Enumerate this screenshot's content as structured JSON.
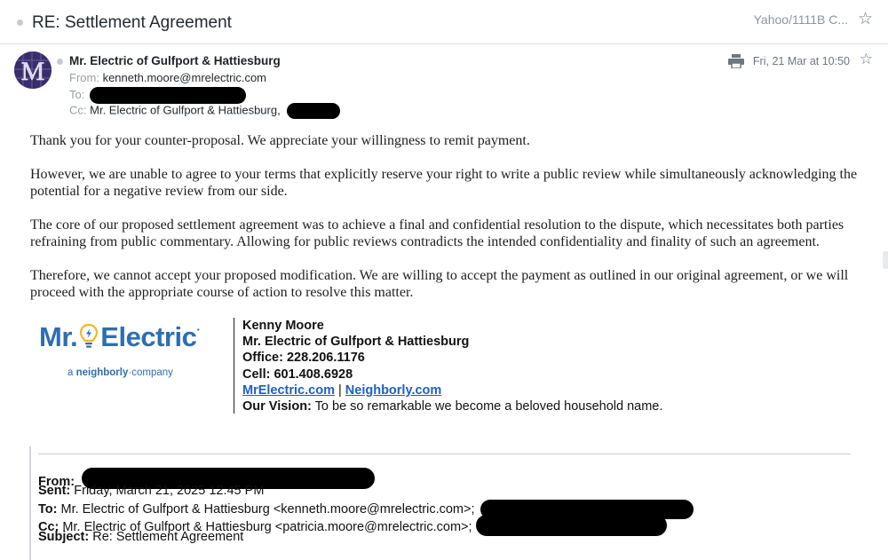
{
  "header": {
    "subject": "RE: Settlement Agreement",
    "folder": "Yahoo/1111B C...",
    "star_icon": "star-outline-icon"
  },
  "message": {
    "sender_name": "Mr. Electric of Gulfport & Hattiesburg",
    "from_label": "From:",
    "from_email": "kenneth.moore@mrelectric.com",
    "to_label": "To:",
    "cc_label": "Cc:",
    "cc_value": "Mr. Electric of Gulfport & Hattiesburg,",
    "date": "Fri, 21 Mar at 10:50",
    "avatar_icon": "avatar-logo-icon",
    "print_icon": "print-icon"
  },
  "body": {
    "p1": "Thank you for your counter-proposal. We appreciate your willingness to remit payment.",
    "p2": "However, we are unable to agree to your terms that explicitly reserve your right to write a public review while simultaneously acknowledging the potential for a negative review from our side.",
    "p3": "The core of our proposed settlement agreement was to achieve a final and confidential resolution to the dispute, which necessitates both parties refraining from public commentary. Allowing for public reviews contradicts the intended confidentiality and finality of such an agreement.",
    "p4": "Therefore, we cannot accept your proposed modification. We are willing to accept the payment as outlined in our original agreement, or we will proceed with the appropriate course of action to resolve this matter."
  },
  "logo": {
    "word_left": "Mr.",
    "word_right": "Electric",
    "reg": "·",
    "tag_a": "a ",
    "tag_brand": "neighborly",
    "tag_rest": "company",
    "brand_color": "#2f6db3",
    "bulb_color": "#f5b81c"
  },
  "signature": {
    "name": "Kenny Moore",
    "company": "Mr. Electric of Gulfport & Hattiesburg",
    "office": "Office: 228.206.1176",
    "cell": "Cell: 601.408.6928",
    "link1": "MrElectric.com",
    "separator": " | ",
    "link2": "Neighborly.com",
    "vision_label": "Our Vision:",
    "vision_text": " To be so remarkable we become a beloved household name."
  },
  "quoted": {
    "from_label": "From:",
    "sent_label": "Sent:",
    "sent_value": " Friday, March 21, 2025 12:45 PM",
    "to_label": "To:",
    "to_value": " Mr. Electric of Gulfport & Hattiesburg <kenneth.moore@mrelectric.com>;",
    "cc_label": "Cc:",
    "cc_value": " Mr. Electric of Gulfport & Hattiesburg <patricia.moore@mrelectric.com>;",
    "subject_label": "Subject:",
    "subject_value": " Re: Settlement Agreement"
  }
}
